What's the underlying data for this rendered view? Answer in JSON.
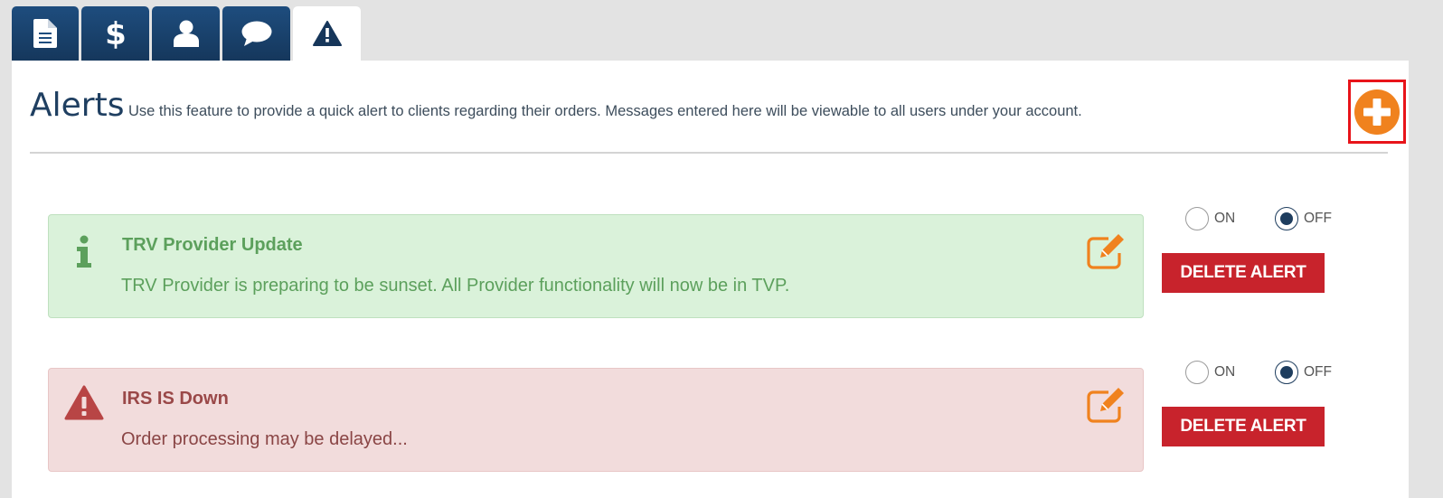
{
  "tabs": [
    {
      "icon": "document-icon",
      "active": false
    },
    {
      "icon": "dollar-icon",
      "active": false
    },
    {
      "icon": "user-icon",
      "active": false
    },
    {
      "icon": "chat-icon",
      "active": false
    },
    {
      "icon": "warning-icon",
      "active": true
    }
  ],
  "header": {
    "title": "Alerts",
    "description": "Use this feature to provide a quick alert to clients regarding their orders. Messages entered here will be viewable to all users under your account.",
    "add_icon": "plus-circle-icon"
  },
  "alerts": [
    {
      "type": "info",
      "icon": "info-icon",
      "title": "TRV Provider Update",
      "message": "TRV Provider is preparing to be sunset. All Provider functionality will now be in TVP.",
      "on_label": "ON",
      "off_label": "OFF",
      "selected": "OFF",
      "delete_label": "DELETE ALERT"
    },
    {
      "type": "danger",
      "icon": "warning-icon",
      "title": "IRS IS Down",
      "message": "Order processing may be delayed...",
      "on_label": "ON",
      "off_label": "OFF",
      "selected": "OFF",
      "delete_label": "DELETE ALERT"
    }
  ],
  "colors": {
    "tab_bg": "#1e4d7e",
    "title": "#1f3f61",
    "add_orange": "#f0821e",
    "highlight_red": "#e8141a",
    "info_bg": "#daf2da",
    "info_text": "#5ca05c",
    "danger_bg": "#f2dcdc",
    "danger_text": "#9a4848",
    "delete_red": "#c8232c",
    "edit_orange": "#f0821e"
  }
}
